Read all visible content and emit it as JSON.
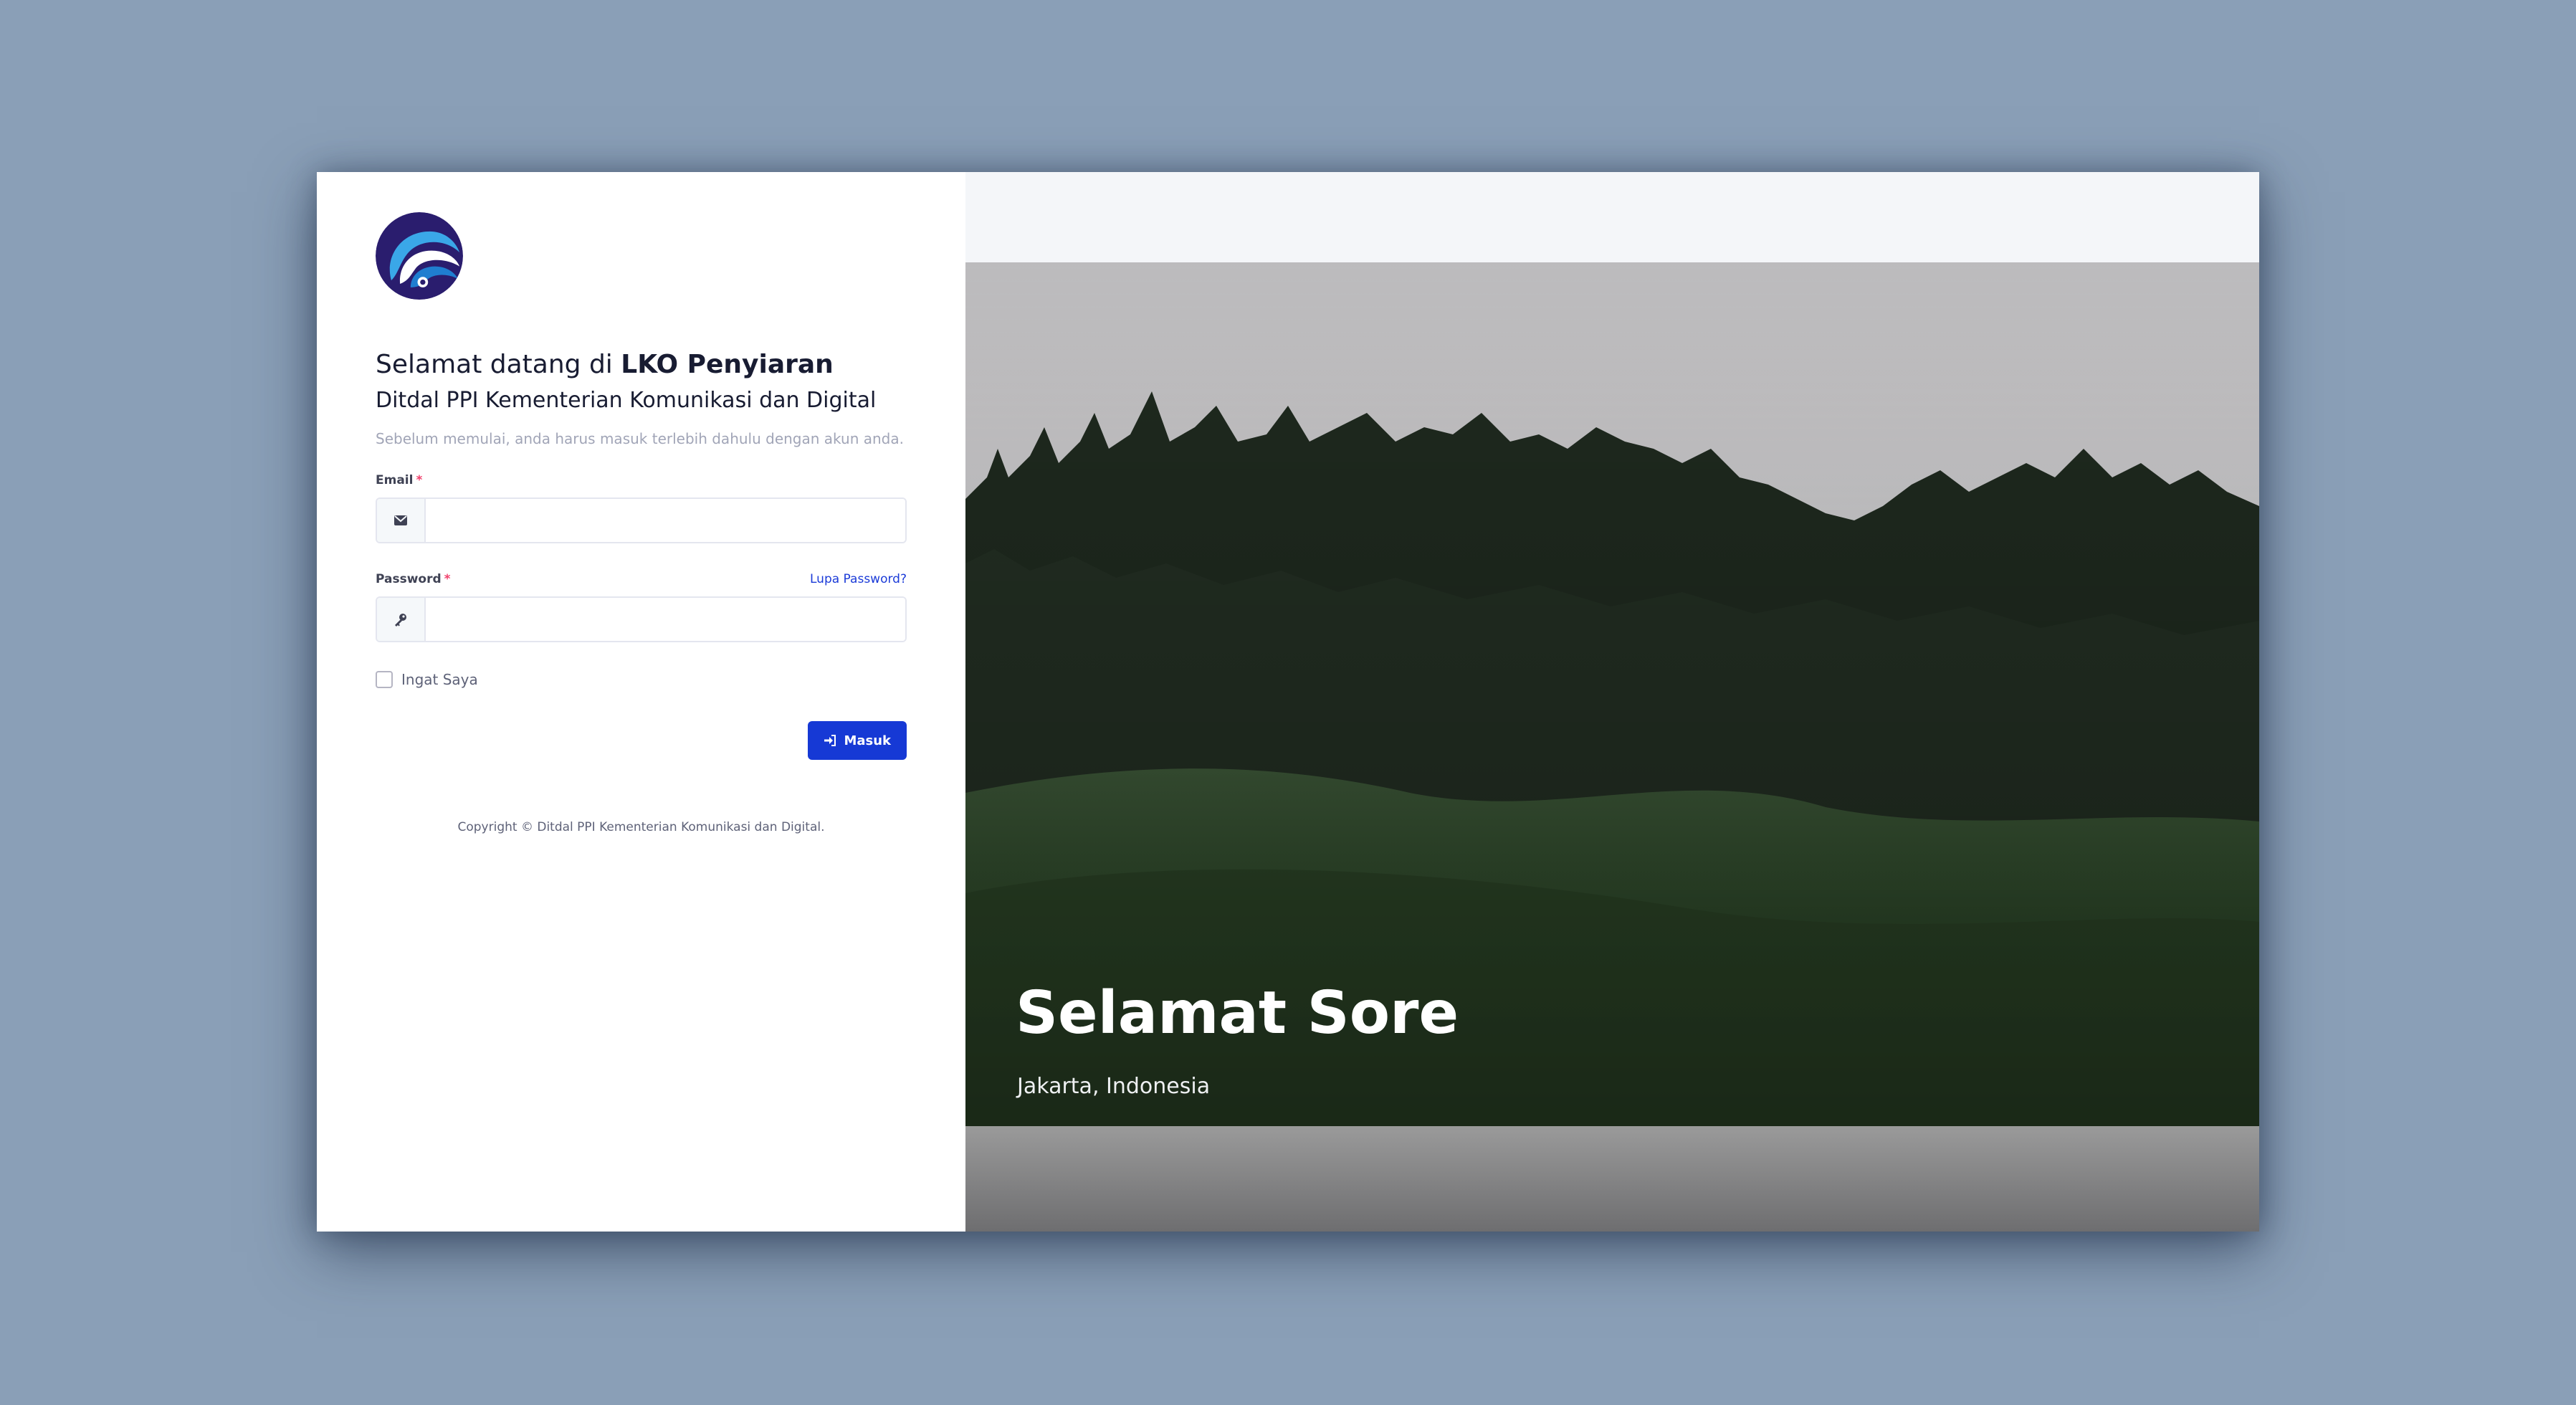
{
  "login": {
    "welcome_prefix": "Selamat datang di ",
    "app_name": "LKO Penyiaran",
    "subtitle": "Ditdal PPI Kementerian Komunikasi dan Digital",
    "hint": "Sebelum memulai, anda harus masuk terlebih dahulu dengan akun anda.",
    "email_label": "Email",
    "email_value": "",
    "password_label": "Password",
    "password_value": "",
    "required_mark": "*",
    "forgot_label": "Lupa Password?",
    "remember_label": "Ingat Saya",
    "submit_label": "Masuk",
    "copyright": "Copyright © Ditdal PPI Kementerian Komunikasi dan Digital."
  },
  "hero": {
    "greeting": "Selamat Sore",
    "location": "Jakarta, Indonesia"
  },
  "icons": {
    "logo": "kominfo-logo",
    "email": "envelope-icon",
    "password": "key-icon",
    "submit": "sign-in-icon"
  },
  "colors": {
    "primary": "#1639d5",
    "required": "#f1416c",
    "page_background": "#8a9fb7"
  }
}
